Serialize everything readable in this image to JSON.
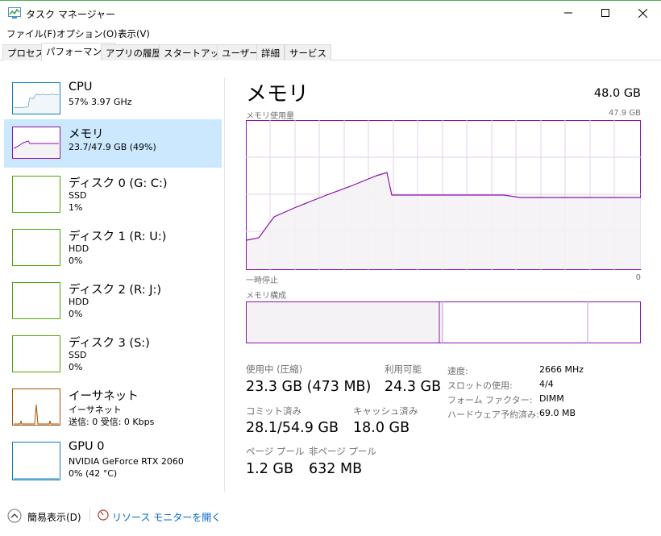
{
  "window": {
    "title": "タスク マネージャー"
  },
  "menu": [
    "ファイル(F)",
    "オプション(O)",
    "表示(V)"
  ],
  "tabs": [
    "プロセス",
    "パフォーマンス",
    "アプリの履歴",
    "スタートアップ",
    "ユーザー",
    "詳細",
    "サービス"
  ],
  "sidebar": [
    {
      "name": "CPU",
      "line1": "57%  3.97 GHz"
    },
    {
      "name": "メモリ",
      "line1": "23.7/47.9 GB (49%)"
    },
    {
      "name": "ディスク 0 (G: C:)",
      "line1": "SSD",
      "line2": "1%"
    },
    {
      "name": "ディスク 1 (R: U:)",
      "line1": "HDD",
      "line2": "0%"
    },
    {
      "name": "ディスク 2 (R: J:)",
      "line1": "HDD",
      "line2": "0%"
    },
    {
      "name": "ディスク 3 (S:)",
      "line1": "SSD",
      "line2": "0%"
    },
    {
      "name": "イーサネット",
      "line1": "イーサネット",
      "line2": "送信: 0  受信: 0 Kbps"
    },
    {
      "name": "GPU 0",
      "line1": "NVIDIA GeForce RTX 2060",
      "line2": "0%  (42 °C)"
    }
  ],
  "main": {
    "title": "メモリ",
    "total": "48.0 GB",
    "usage_label": "メモリ使用量",
    "usage_max": "47.9 GB",
    "time_label": "一時停止",
    "time_zero": "0",
    "composition_label": "メモリ構成",
    "stats": {
      "in_use_label": "使用中 (圧縮)",
      "in_use_value": "23.3 GB (473 MB)",
      "available_label": "利用可能",
      "available_value": "24.3 GB",
      "committed_label": "コミット済み",
      "committed_value": "28.1/54.9 GB",
      "cached_label": "キャッシュ済み",
      "cached_value": "18.0 GB",
      "paged_label": "ページ プール",
      "paged_value": "1.2 GB",
      "nonpaged_label": "非ページ プール",
      "nonpaged_value": "632 MB"
    },
    "details": [
      {
        "label": "速度:",
        "value": "2666 MHz"
      },
      {
        "label": "スロットの使用:",
        "value": "4/4"
      },
      {
        "label": "フォーム ファクター:",
        "value": "DIMM"
      },
      {
        "label": "ハードウェア予約済み:",
        "value": "69.0 MB"
      }
    ]
  },
  "footer": {
    "fewer_details": "簡易表示(D)",
    "open_monitor": "リソース モニターを開く"
  },
  "colors": {
    "memory": "#8b12ae",
    "cpu": "#117dbb",
    "disk": "#4da60c",
    "ethernet": "#a74f01",
    "selected": "#cce8ff",
    "link": "#0066cc"
  }
}
